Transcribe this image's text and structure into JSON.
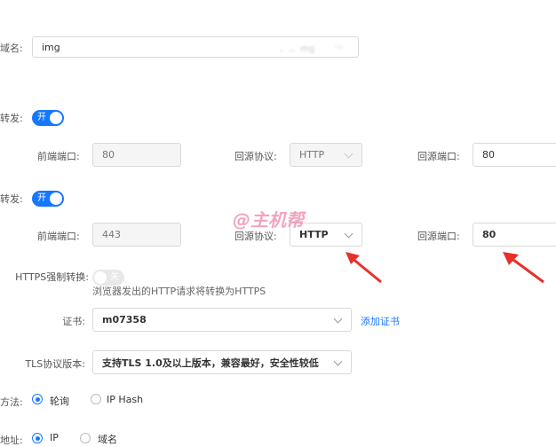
{
  "domain": {
    "label": "域名:",
    "value": "img",
    "masked_suffix": "、.、​mg",
    "masked_tail": "～"
  },
  "http_forward": {
    "label": "转发:",
    "toggle_text": "开",
    "front_port_label": "前端端口:",
    "front_port_value": "80",
    "origin_protocol_label": "回源协议:",
    "origin_protocol_value": "HTTP",
    "origin_port_label": "回源端口:",
    "origin_port_value": "80"
  },
  "https_forward": {
    "label": "转发:",
    "toggle_text": "开",
    "front_port_label": "前端端口:",
    "front_port_value": "443",
    "origin_protocol_label": "回源协议:",
    "origin_protocol_value": "HTTP",
    "origin_port_label": "回源端口:",
    "origin_port_value": "80"
  },
  "watermark": "@主机帮",
  "https_force": {
    "label": "HTTPS强制转换:",
    "toggle_text": "关",
    "hint": "浏览器发出的HTTP请求将转换为HTTPS"
  },
  "certificate": {
    "label": "证书:",
    "value": "m07358",
    "add_link": "添加证书"
  },
  "tls": {
    "label": "TLS协议版本:",
    "value": "支持TLS 1.0及以上版本，兼容最好，安全性较低"
  },
  "balance": {
    "label": "方法:",
    "options": [
      "轮询",
      "IP Hash"
    ]
  },
  "origin_address": {
    "label": "地址:",
    "options": [
      "IP",
      "域名"
    ]
  },
  "colors": {
    "accent": "#1677ff",
    "arrow": "#e8302a",
    "watermark": "#e85a8a"
  }
}
